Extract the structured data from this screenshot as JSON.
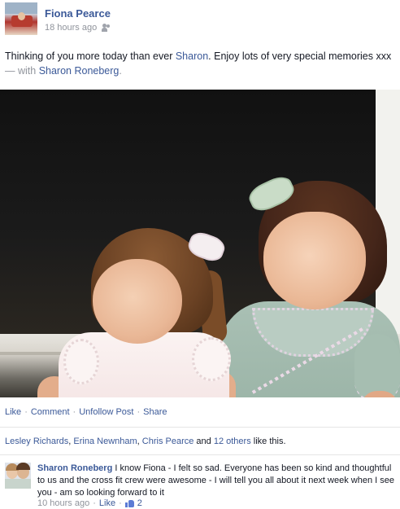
{
  "post": {
    "author": "Fiona Pearce",
    "timestamp": "18 hours ago",
    "audience_icon": "friends-audience-icon",
    "text_before": "Thinking of you more today than ever ",
    "text_mention": "Sharon",
    "text_after": ". Enjoy lots of very special memories xxx",
    "with_prefix": " — with ",
    "with_person": "Sharon Roneberg",
    "with_suffix": "."
  },
  "actions": {
    "like": "Like",
    "comment": "Comment",
    "unfollow": "Unfollow Post",
    "share": "Share",
    "separator": "·"
  },
  "likes": {
    "person1": "Lesley Richards",
    "sep1": ", ",
    "person2": "Erina Newnham",
    "sep2": ", ",
    "person3": "Chris Pearce",
    "and": " and ",
    "others": "12 others",
    "suffix": " like this."
  },
  "comment": {
    "author": "Sharon Roneberg",
    "text": " I know Fiona - I felt so sad. Everyone has been so kind and thoughtful to us and the cross fit crew were awesome - I will tell you all about it next week when I see you - am so looking forward to it",
    "timestamp": "10 hours ago",
    "like": "Like",
    "like_count": "2"
  },
  "colors": {
    "link": "#3b5998",
    "meta": "#90949c",
    "text": "#141823"
  }
}
